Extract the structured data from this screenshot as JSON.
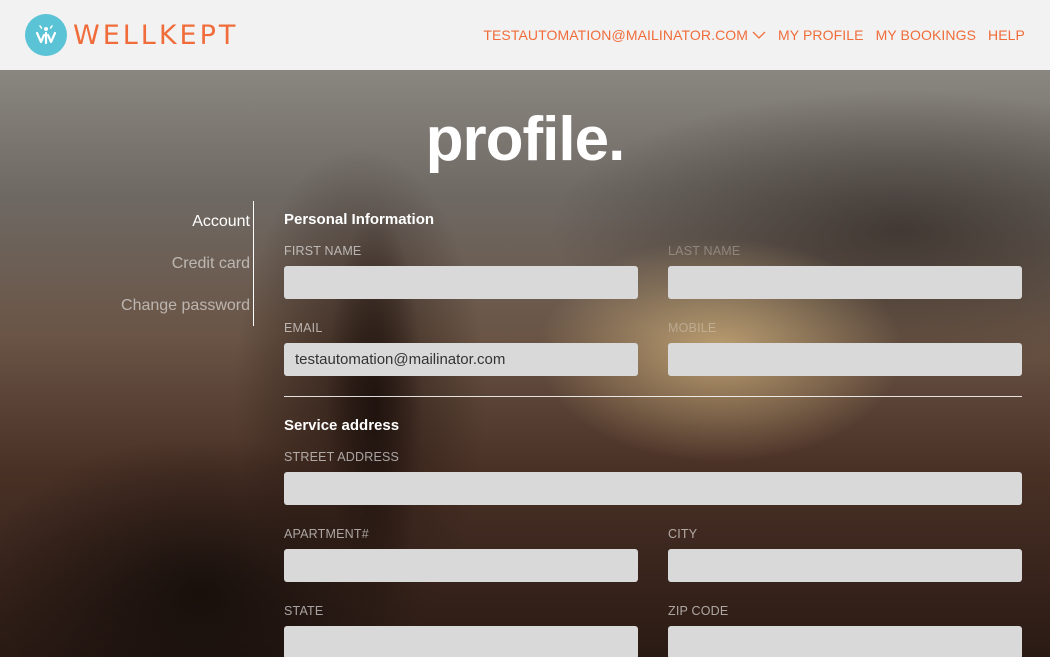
{
  "header": {
    "logo_text": "WELLKEPT",
    "nav": {
      "account_email": "TESTAUTOMATION@MAILINATOR.COM",
      "my_profile": "MY PROFILE",
      "my_bookings": "MY BOOKINGS",
      "help": "HELP"
    }
  },
  "colors": {
    "brand_orange": "#f06d3b",
    "logo_circle": "#5bc3d6",
    "header_bg": "#f2f2f2",
    "input_bg": "#d9d9d9"
  },
  "page": {
    "title": "profile."
  },
  "side_menu": {
    "items": [
      {
        "label": "Account",
        "active": true
      },
      {
        "label": "Credit card",
        "active": false
      },
      {
        "label": "Change password",
        "active": false
      }
    ]
  },
  "personal_information": {
    "title": "Personal Information",
    "first_name": {
      "label": "FIRST NAME",
      "value": ""
    },
    "last_name": {
      "label": "LAST NAME",
      "value": ""
    },
    "email": {
      "label": "EMAIL",
      "value": "testautomation@mailinator.com"
    },
    "mobile": {
      "label": "MOBILE",
      "value": ""
    }
  },
  "service_address": {
    "title": "Service address",
    "street_address": {
      "label": "STREET ADDRESS",
      "value": ""
    },
    "apartment": {
      "label": "APARTMENT#",
      "value": ""
    },
    "city": {
      "label": "CITY",
      "value": ""
    },
    "state": {
      "label": "STATE",
      "value": ""
    },
    "zip_code": {
      "label": "ZIP CODE",
      "value": ""
    }
  }
}
